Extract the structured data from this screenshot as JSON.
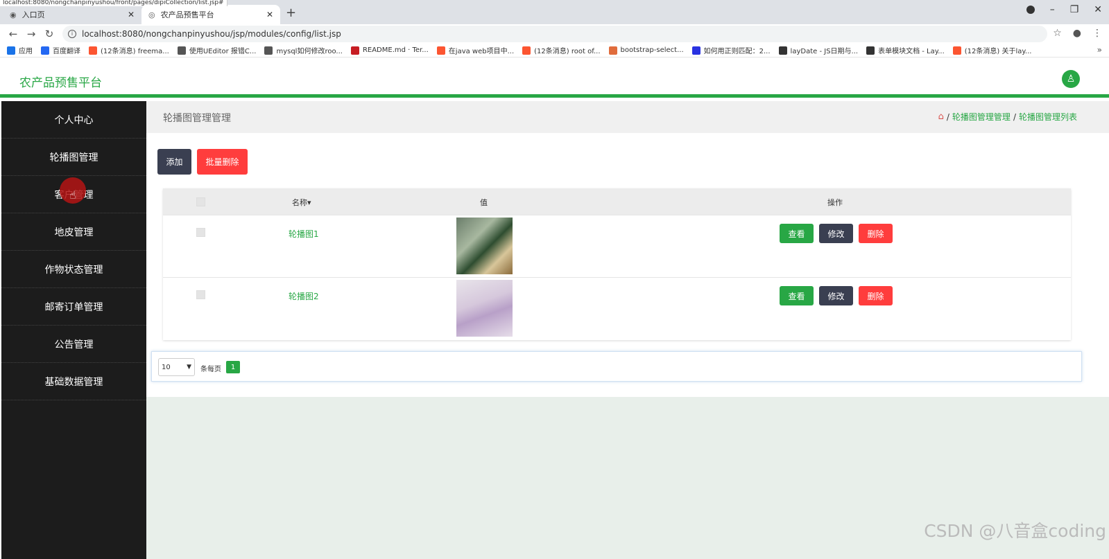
{
  "browser": {
    "status_url": "localhost:8080/nongchanpinyushou/front/pages/dipiCollection/list.jsp#",
    "tabs": [
      {
        "label": "入口页",
        "icon": "globe-icon"
      },
      {
        "label": "农产品预售平台",
        "icon": "location-icon"
      }
    ],
    "new_tab": "+",
    "address": "localhost:8080/nongchanpinyushou/jsp/modules/config/list.jsp",
    "bookmarks": [
      {
        "label": "应用",
        "color": "#1a73e8"
      },
      {
        "label": "百度翻译",
        "color": "#2468f2"
      },
      {
        "label": "(12条消息) freema...",
        "color": "#fc5531"
      },
      {
        "label": "使用UEditor 报错C...",
        "color": "#555555"
      },
      {
        "label": "mysql如何修改roo...",
        "color": "#555555"
      },
      {
        "label": "README.md · Ter...",
        "color": "#c71d23"
      },
      {
        "label": "在java web项目中...",
        "color": "#fc5531"
      },
      {
        "label": "(12条消息) root of...",
        "color": "#fc5531"
      },
      {
        "label": "bootstrap-select...",
        "color": "#e06c3c"
      },
      {
        "label": "如何用正则匹配：2...",
        "color": "#2932e1"
      },
      {
        "label": "layDate - JS日期与...",
        "color": "#333333"
      },
      {
        "label": "表单模块文档 - Lay...",
        "color": "#333333"
      },
      {
        "label": "(12条消息) 关于lay...",
        "color": "#fc5531"
      }
    ],
    "bookmarks_more": "»"
  },
  "header": {
    "title": "农产品预售平台",
    "accent": "#28a745"
  },
  "sidebar": {
    "items": [
      {
        "label": "个人中心"
      },
      {
        "label": "轮播图管理"
      },
      {
        "label": "客户管理"
      },
      {
        "label": "地皮管理"
      },
      {
        "label": "作物状态管理"
      },
      {
        "label": "邮寄订单管理"
      },
      {
        "label": "公告管理"
      },
      {
        "label": "基础数据管理"
      }
    ]
  },
  "main": {
    "page_title": "轮播图管理管理",
    "breadcrumb": [
      "轮播图管理管理",
      "轮播图管理列表"
    ],
    "breadcrumb_sep": "/",
    "buttons": {
      "add": "添加",
      "batch_delete": "批量删除"
    },
    "table": {
      "headers": {
        "name": "名称",
        "value": "值",
        "actions": "操作"
      },
      "sort_indicator": "▾",
      "rows": [
        {
          "name": "轮播图1",
          "view": "查看",
          "edit": "修改",
          "delete": "删除"
        },
        {
          "name": "轮播图2",
          "view": "查看",
          "edit": "修改",
          "delete": "删除"
        }
      ]
    },
    "pager": {
      "page_size": "10",
      "per_page_label": "条每页",
      "current_page": "1"
    }
  },
  "watermark": "CSDN @八音盒coding"
}
